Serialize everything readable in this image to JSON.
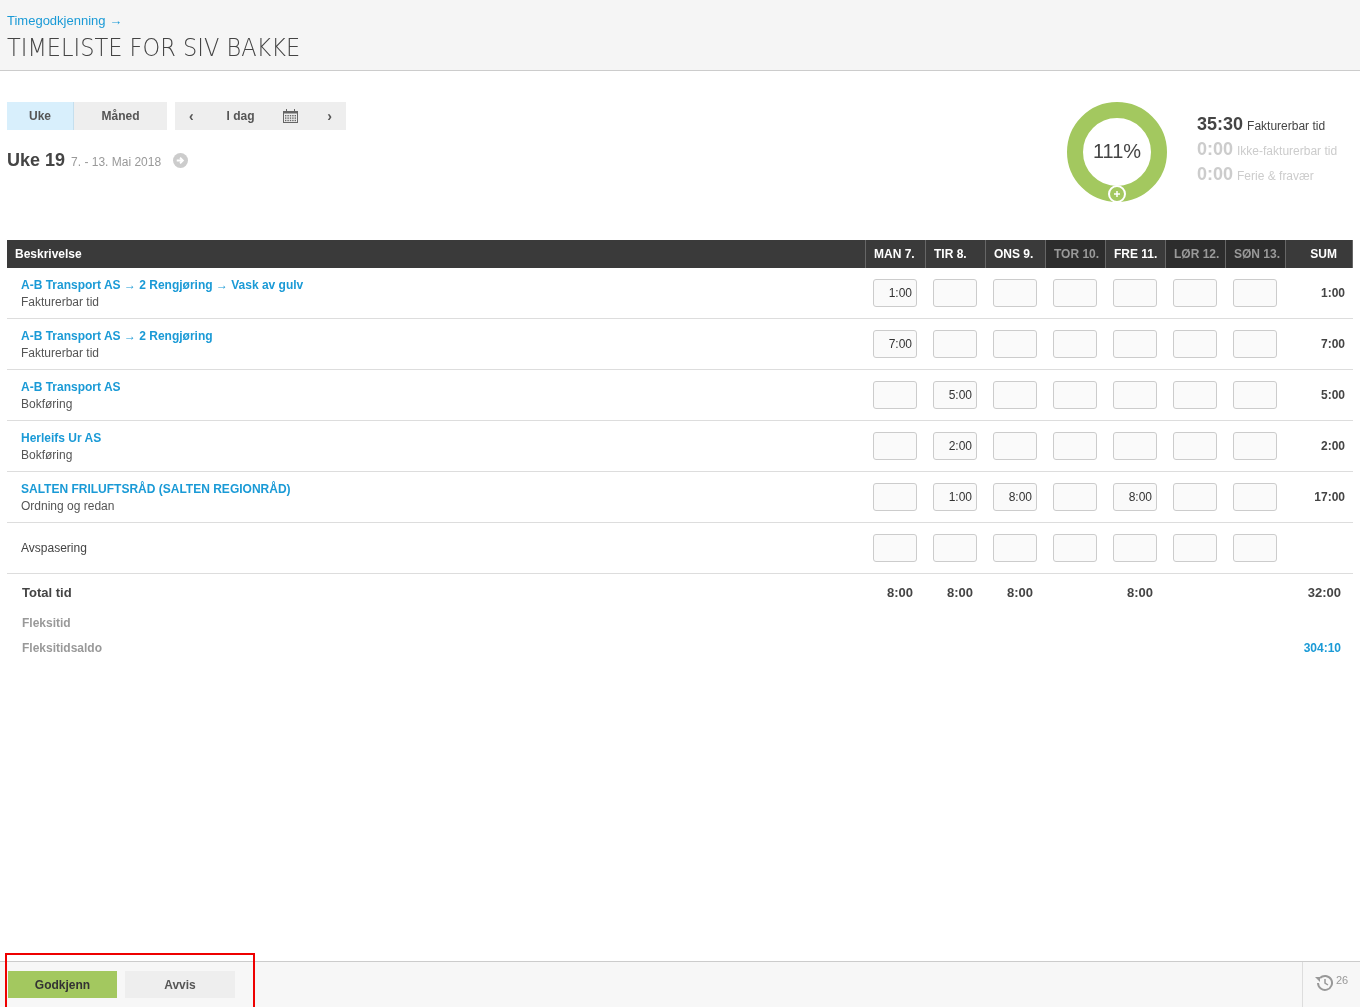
{
  "breadcrumb": "Timegodkjenning →",
  "title": "TIMELISTE FOR SIV BAKKE",
  "view_tabs": [
    {
      "label": "Uke",
      "selected": true
    },
    {
      "label": "Måned",
      "selected": false
    }
  ],
  "nav": {
    "prev": "‹",
    "today": "I dag",
    "next": "›"
  },
  "week": {
    "label": "Uke 19",
    "range": "7. - 13. Mai 2018"
  },
  "summary": {
    "percent": "111%",
    "lines": [
      {
        "value": "35:30",
        "label": "Fakturerbar tid",
        "dimmed": false
      },
      {
        "value": "0:00",
        "label": "Ikke-fakturerbar tid",
        "dimmed": true
      },
      {
        "value": "0:00",
        "label": "Ferie & fravær",
        "dimmed": true
      }
    ]
  },
  "table": {
    "description_header": "Beskrivelse",
    "sum_header": "SUM",
    "days": [
      {
        "label": "MAN 7.",
        "dimmed": false
      },
      {
        "label": "TIR 8.",
        "dimmed": false
      },
      {
        "label": "ONS 9.",
        "dimmed": false
      },
      {
        "label": "TOR 10.",
        "dimmed": true
      },
      {
        "label": "FRE 11.",
        "dimmed": false
      },
      {
        "label": "LØR 12.",
        "dimmed": true
      },
      {
        "label": "SØN 13.",
        "dimmed": true
      }
    ],
    "rows": [
      {
        "kind": "project",
        "title": "A-B Transport AS → 2 Rengjøring → Vask av gulv",
        "subtitle": "Fakturerbar tid",
        "cells": [
          {
            "hours": "1:00"
          },
          {},
          {},
          {},
          {},
          {},
          {}
        ],
        "sum": "1:00"
      },
      {
        "kind": "project",
        "title": "A-B Transport AS → 2 Rengjøring",
        "subtitle": "Fakturerbar tid",
        "cells": [
          {
            "hours": "7:00"
          },
          {},
          {},
          {},
          {},
          {},
          {}
        ],
        "sum": "7:00"
      },
      {
        "kind": "project",
        "title": "A-B Transport AS",
        "subtitle": "Bokføring",
        "cells": [
          {},
          {
            "hours": "5:00"
          },
          {},
          {},
          {},
          {},
          {}
        ],
        "sum": "5:00"
      },
      {
        "kind": "project",
        "title": "Herleifs Ur AS",
        "subtitle": "Bokføring",
        "cells": [
          {},
          {
            "hours": "2:00"
          },
          {},
          {},
          {},
          {},
          {}
        ],
        "sum": "2:00"
      },
      {
        "kind": "project",
        "title": "SALTEN FRILUFTSRÅD (SALTEN REGIONRÅD)",
        "subtitle": "Ordning og redan",
        "cells": [
          {},
          {
            "hours": "1:00"
          },
          {
            "hours": "8:00"
          },
          {},
          {
            "hours": "8:00"
          },
          {},
          {}
        ],
        "sum": "17:00"
      },
      {
        "kind": "plain",
        "title": "Avspasering",
        "cells": [
          {},
          {},
          {},
          {},
          {},
          {},
          {}
        ]
      }
    ],
    "totals": [
      {
        "kind": "main",
        "label": "Total tid",
        "cells": [
          {
            "hours": "8:00"
          },
          {
            "hours": "8:00"
          },
          {
            "hours": "8:00"
          },
          {},
          {
            "hours": "8:00"
          },
          {},
          {}
        ],
        "sum": "32:00"
      },
      {
        "kind": "muted",
        "label": "Fleksitid",
        "cells": [
          {},
          {},
          {},
          {},
          {},
          {},
          {}
        ]
      },
      {
        "kind": "muted",
        "label": "Fleksitidsaldo",
        "cells": [
          {},
          {},
          {},
          {},
          {},
          {},
          {}
        ],
        "sum": "304:10"
      }
    ]
  },
  "footer": {
    "buttons": [
      {
        "label": "Godkjenn",
        "kind": "primary"
      },
      {
        "label": "Avvis",
        "kind": "secondary"
      }
    ],
    "history_count": "26"
  }
}
